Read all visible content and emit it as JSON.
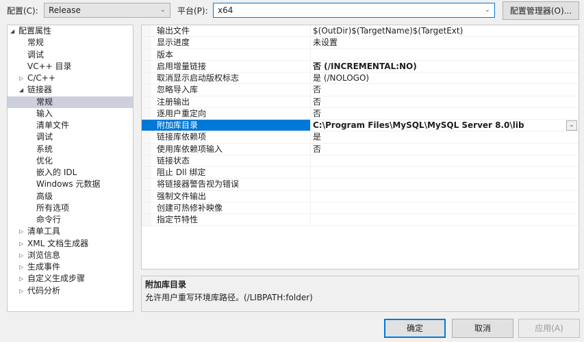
{
  "toolbar": {
    "config_label": "配置(C):",
    "config_value": "Release",
    "platform_label": "平台(P):",
    "platform_value": "x64",
    "config_manager": "配置管理器(O)..."
  },
  "tree": [
    {
      "label": "配置属性",
      "level": 0,
      "expander": "expanded"
    },
    {
      "label": "常规",
      "level": 1
    },
    {
      "label": "调试",
      "level": 1
    },
    {
      "label": "VC++ 目录",
      "level": 1
    },
    {
      "label": "C/C++",
      "level": 1,
      "expander": "collapsed"
    },
    {
      "label": "链接器",
      "level": 1,
      "expander": "expanded"
    },
    {
      "label": "常规",
      "level": 2,
      "selected": true
    },
    {
      "label": "输入",
      "level": 2
    },
    {
      "label": "清单文件",
      "level": 2
    },
    {
      "label": "调试",
      "level": 2
    },
    {
      "label": "系统",
      "level": 2
    },
    {
      "label": "优化",
      "level": 2
    },
    {
      "label": "嵌入的 IDL",
      "level": 2
    },
    {
      "label": "Windows 元数据",
      "level": 2
    },
    {
      "label": "高级",
      "level": 2
    },
    {
      "label": "所有选项",
      "level": 2
    },
    {
      "label": "命令行",
      "level": 2
    },
    {
      "label": "清单工具",
      "level": 1,
      "expander": "collapsed"
    },
    {
      "label": "XML 文档生成器",
      "level": 1,
      "expander": "collapsed"
    },
    {
      "label": "浏览信息",
      "level": 1,
      "expander": "collapsed"
    },
    {
      "label": "生成事件",
      "level": 1,
      "expander": "collapsed"
    },
    {
      "label": "自定义生成步骤",
      "level": 1,
      "expander": "collapsed"
    },
    {
      "label": "代码分析",
      "level": 1,
      "expander": "collapsed"
    }
  ],
  "properties": [
    {
      "name": "输出文件",
      "value": "$(OutDir)$(TargetName)$(TargetExt)"
    },
    {
      "name": "显示进度",
      "value": "未设置"
    },
    {
      "name": "版本",
      "value": ""
    },
    {
      "name": "启用增量链接",
      "value": "否 (/INCREMENTAL:NO)",
      "bold": true
    },
    {
      "name": "取消显示启动版权标志",
      "value": "是 (/NOLOGO)"
    },
    {
      "name": "忽略导入库",
      "value": "否"
    },
    {
      "name": "注册输出",
      "value": "否"
    },
    {
      "name": "逐用户重定向",
      "value": "否"
    },
    {
      "name": "附加库目录",
      "value": "C:\\Program Files\\MySQL\\MySQL Server 8.0\\lib",
      "selected": true
    },
    {
      "name": "链接库依赖项",
      "value": "是"
    },
    {
      "name": "使用库依赖项输入",
      "value": "否"
    },
    {
      "name": "链接状态",
      "value": ""
    },
    {
      "name": "阻止 Dll 绑定",
      "value": ""
    },
    {
      "name": "将链接器警告视为错误",
      "value": ""
    },
    {
      "name": "强制文件输出",
      "value": ""
    },
    {
      "name": "创建可热修补映像",
      "value": ""
    },
    {
      "name": "指定节特性",
      "value": ""
    }
  ],
  "description": {
    "title": "附加库目录",
    "text": "允许用户重写环境库路径。(/LIBPATH:folder)"
  },
  "buttons": {
    "ok": "确定",
    "cancel": "取消",
    "apply": "应用(A)"
  },
  "colors": {
    "accent": "#0078d7",
    "tree_selection": "#cdd0dc"
  }
}
